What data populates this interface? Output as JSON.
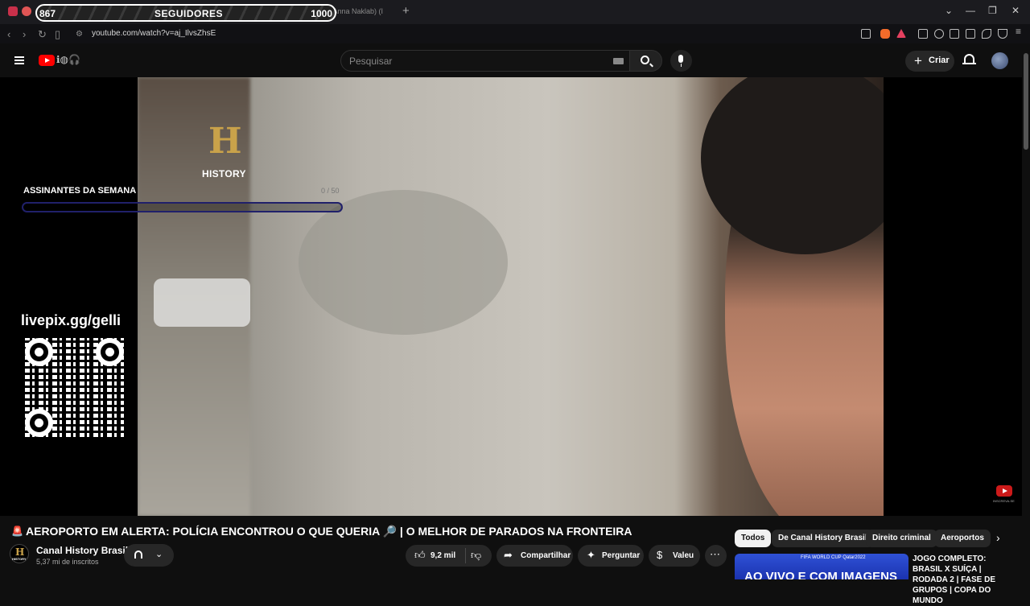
{
  "browser": {
    "tab_title": "ked G... st. Anna Naklab) (I",
    "url": "youtube.com/watch?v=aj_IlvsZhsE"
  },
  "followers_overlay": {
    "current": "867",
    "label": "SEGUIDORES",
    "goal": "1000",
    "progress": 0.867
  },
  "header": {
    "search_placeholder": "Pesquisar",
    "create_label": "Criar"
  },
  "player": {
    "channel_logo_text": "HISTORY",
    "subs_overlay": {
      "title": "ASSINANTES DA SEMANA",
      "count": "0 / 50",
      "progress": 0
    },
    "qr_card": {
      "title": "livepix.gg/gelli"
    },
    "subscribe_mini_label": "INSCREVA-SE"
  },
  "video": {
    "title_icon": "🚨",
    "title": "AEROPORTO EM ALERTA: POLÍCIA ENCONTROU O QUE QUERIA 🔎 | O MELHOR DE PARADOS NA FRONTEIRA",
    "channel_name": "Canal History Brasil",
    "channel_subs": "5,37 mi de inscritos",
    "channel_avatar_text": "HISTORY",
    "likes": "9,2 mil",
    "share_label": "Compartilhar",
    "ask_label": "Perguntar",
    "thanks_label": "Valeu"
  },
  "chips": [
    "Todos",
    "De Canal History Brasil",
    "Direito criminal",
    "Aeroportos"
  ],
  "recommended": {
    "thumb_badge": "FIFA WORLD CUP Qatar2022",
    "thumb_text": "AO VIVO E COM IMAGENS",
    "title": "JOGO COMPLETO: BRASIL X SUÍÇA | RODADA 2 | FASE DE GRUPOS | COPA DO MUNDO"
  }
}
